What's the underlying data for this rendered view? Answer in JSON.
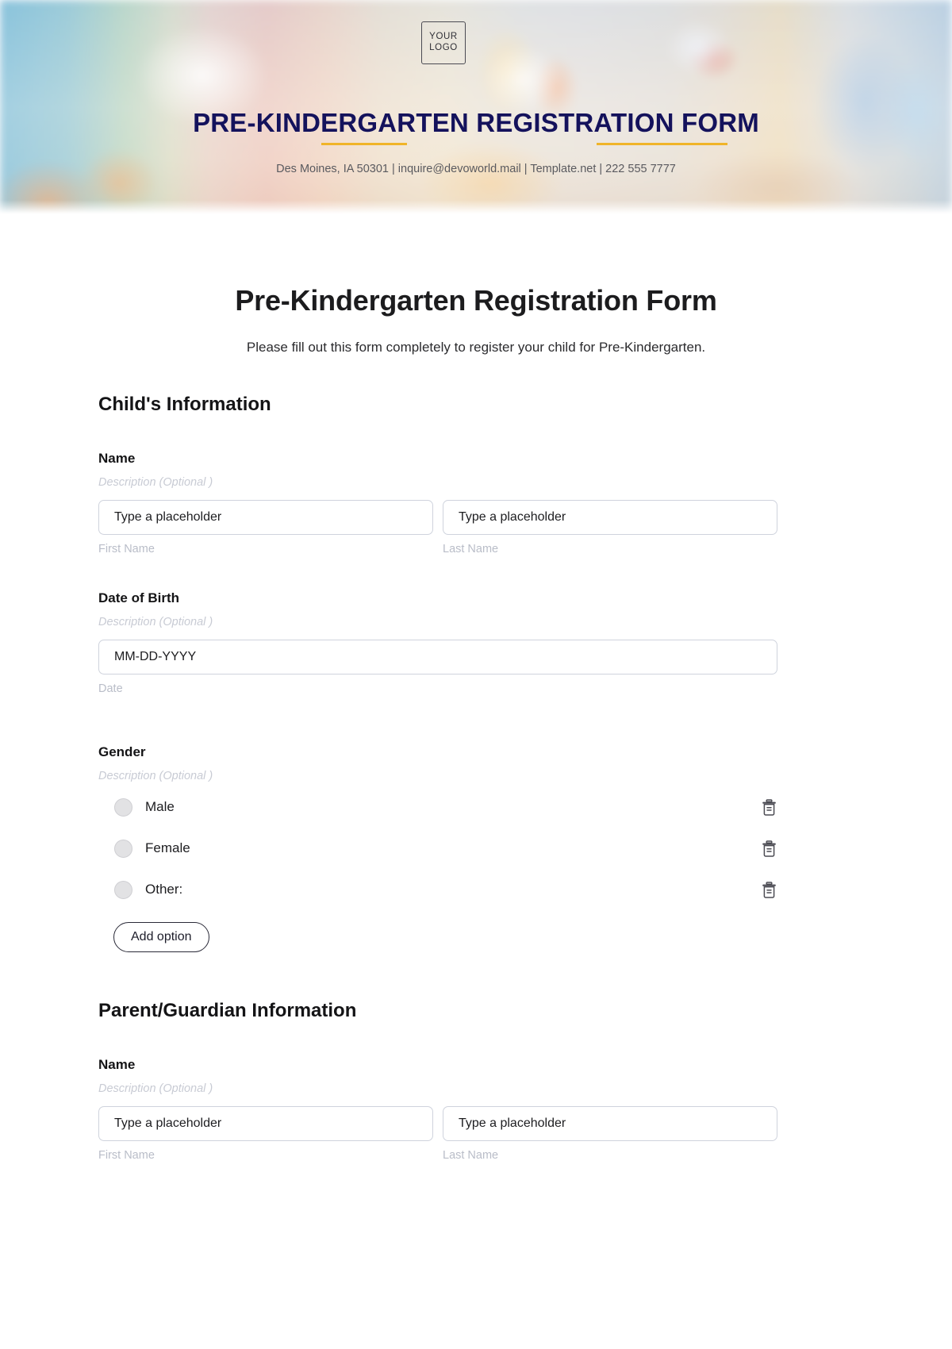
{
  "banner": {
    "logo_line1": "YOUR",
    "logo_line2": "LOGO",
    "title": "PRE-KINDERGARTEN REGISTRATION FORM",
    "contact": "Des Moines, IA 50301 | inquire@devoworld.mail | Template.net | 222 555 7777",
    "accent_rule_color": "#f0b429",
    "title_color": "#14125c"
  },
  "form": {
    "title": "Pre-Kindergarten Registration Form",
    "subtitle": "Please fill out this form completely to register your child for Pre-Kindergarten.",
    "description_placeholder": "Description  (Optional )",
    "text_placeholder": "Type a placeholder",
    "date_placeholder": "MM-DD-YYYY"
  },
  "sections": [
    {
      "heading": "Child's Information",
      "fields": [
        {
          "label": "Name",
          "description": "Description  (Optional )",
          "type": "name",
          "inputs": [
            {
              "placeholder": "Type a placeholder",
              "sub_label": "First Name"
            },
            {
              "placeholder": "Type a placeholder",
              "sub_label": "Last Name"
            }
          ]
        },
        {
          "label": "Date of Birth",
          "description": "Description  (Optional )",
          "type": "date",
          "inputs": [
            {
              "placeholder": "MM-DD-YYYY",
              "sub_label": "Date"
            }
          ]
        },
        {
          "label": "Gender",
          "description": "Description  (Optional )",
          "type": "radio",
          "options": [
            {
              "label": "Male",
              "delete_icon": "trash-icon"
            },
            {
              "label": "Female",
              "delete_icon": "trash-icon"
            },
            {
              "label": "Other:",
              "delete_icon": "trash-icon"
            }
          ],
          "add_option_label": "Add option"
        }
      ]
    },
    {
      "heading": "Parent/Guardian Information",
      "fields": [
        {
          "label": "Name",
          "description": "Description  (Optional )",
          "type": "name",
          "inputs": [
            {
              "placeholder": "Type a placeholder",
              "sub_label": "First Name"
            },
            {
              "placeholder": "Type a placeholder",
              "sub_label": "Last Name"
            }
          ]
        }
      ]
    }
  ]
}
